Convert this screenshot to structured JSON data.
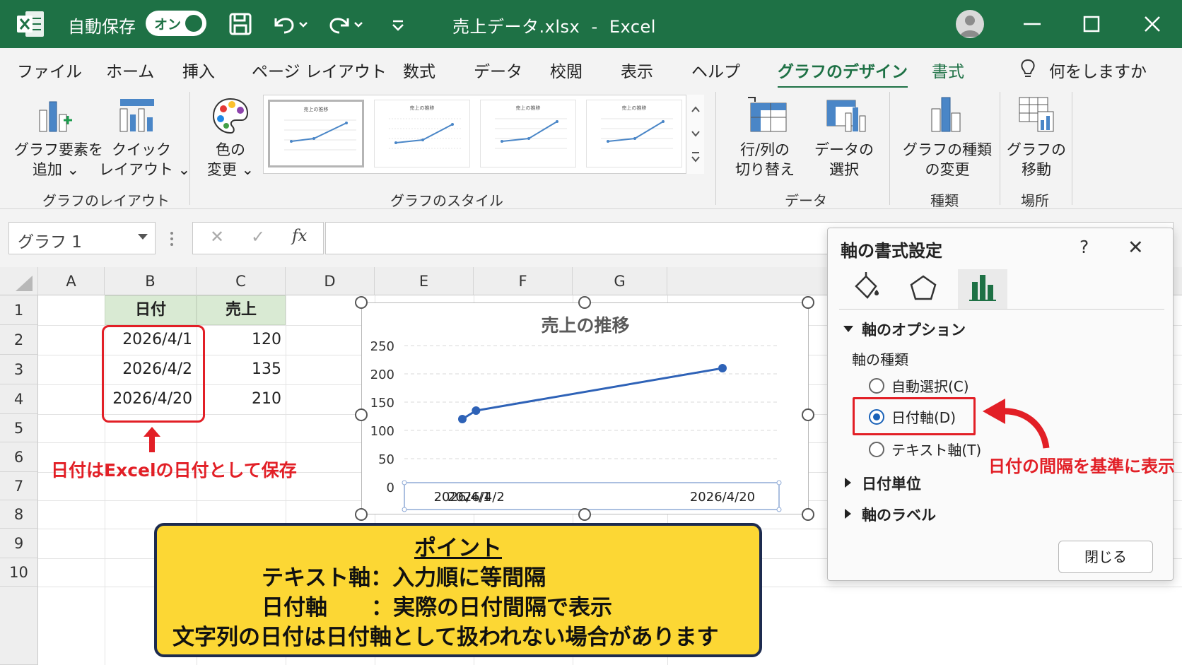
{
  "titlebar": {
    "autosave_label": "自動保存",
    "toggle_label": "オン",
    "document_title": "売上データ.xlsx  -  Excel",
    "icons": [
      "excel-logo-icon",
      "save-icon",
      "undo-icon",
      "redo-icon",
      "customize-qat-icon",
      "account-icon",
      "minimize-icon",
      "maximize-icon",
      "close-icon"
    ]
  },
  "tabs": {
    "file": "ファイル",
    "home": "ホーム",
    "insert": "挿入",
    "page_layout": "ページ レイアウト",
    "formulas": "数式",
    "data": "データ",
    "review": "校閲",
    "view": "表示",
    "help": "ヘルプ",
    "chart_design": "グラフのデザイン",
    "format": "書式",
    "tell_me": "何をしますか"
  },
  "ribbon": {
    "add_element_1": "グラフ要素を",
    "add_element_2": "追加 ⌄",
    "quick_layout_1": "クイック",
    "quick_layout_2": "レイアウト ⌄",
    "group_layout": "グラフのレイアウト",
    "change_colors_1": "色の",
    "change_colors_2": "変更 ⌄",
    "group_styles": "グラフのスタイル",
    "style_thumb_title": "売上の推移",
    "switch_row_col_1": "行/列の",
    "switch_row_col_2": "切り替え",
    "select_data_1": "データの",
    "select_data_2": "選択",
    "group_data": "データ",
    "change_type_1": "グラフの種類",
    "change_type_2": "の変更",
    "group_type": "種類",
    "move_chart_1": "グラフの",
    "move_chart_2": "移動",
    "group_location": "場所"
  },
  "formula_bar": {
    "name_box": "グラフ 1",
    "cancel": "✕",
    "enter": "✓",
    "fx": "fx"
  },
  "sheet": {
    "columns": [
      "A",
      "B",
      "C",
      "D",
      "E",
      "F",
      "G"
    ],
    "rows": [
      "1",
      "2",
      "3",
      "4",
      "5",
      "6",
      "7",
      "8",
      "9",
      "10"
    ],
    "header_date": "日付",
    "header_sales": "売上",
    "dates": [
      "2026/4/1",
      "2026/4/2",
      "2026/4/20"
    ],
    "sales": [
      "120",
      "135",
      "210"
    ]
  },
  "annotations": {
    "left_note": "日付はExcelの日付として保存",
    "right_note": "日付の間隔を基準に表示"
  },
  "chart_data": {
    "type": "line",
    "title": "売上の推移",
    "x": [
      "2026/4/1",
      "2026/4/2",
      "2026/4/20"
    ],
    "series": [
      {
        "values": [
          120,
          135,
          210
        ]
      }
    ],
    "ylim": [
      0,
      250
    ],
    "yticks": [
      "0",
      "50",
      "100",
      "150",
      "200",
      "250"
    ],
    "x_axis_type": "date",
    "grid": "horizontal dashed",
    "line_color": "#2e62b7"
  },
  "callout": {
    "heading": "ポイント",
    "line1": "テキスト軸：入力順に等間隔",
    "line2": "日付軸　　：実際の日付間隔で表示",
    "line3": "文字列の日付は日付軸として扱われない場合があります"
  },
  "format_pane": {
    "title": "軸の書式設定",
    "help": "?",
    "close": "✕",
    "axis_options": "軸のオプション",
    "axis_type": "軸の種類",
    "radio_auto": "自動選択(C)",
    "radio_date": "日付軸(D)",
    "radio_text": "テキスト軸(T)",
    "date_units": "日付単位",
    "axis_labels": "軸のラベル",
    "close_button": "閉じる",
    "selected": "日付軸(D)"
  },
  "colors": {
    "excel_green": "#1e7145",
    "annotation_red": "#e21f26",
    "callout_yellow": "#fcd734",
    "selected_radio": "#1a62b8"
  }
}
